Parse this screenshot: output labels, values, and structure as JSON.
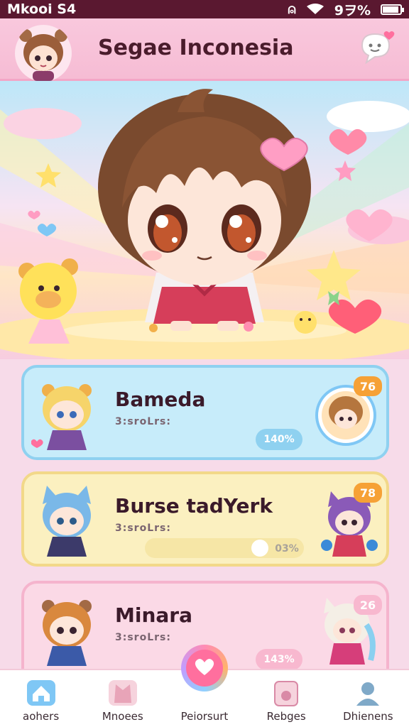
{
  "status": {
    "carrier": "Mkooi S4",
    "battery": "9ヲ%"
  },
  "header": {
    "title": "Segae Inconesia"
  },
  "cards": [
    {
      "name": "Bameda",
      "sub": "3:sroLrs:",
      "badge": "76",
      "pill": "140%"
    },
    {
      "name": "Burse tadYerk",
      "sub": "3:sroLrs:",
      "badge": "78",
      "pill": "03%",
      "progress": 0.03
    },
    {
      "name": "Minara",
      "sub": "3:sroLrs:",
      "badge": "26",
      "pill": "143%"
    }
  ],
  "nav": {
    "items": [
      "aohers",
      "Mnoees",
      "Peiorsurt",
      "Rebges",
      "Dhienens"
    ]
  },
  "colors": {
    "accent": "#ff6f9e",
    "badge": "#f6a136",
    "header": "#f6bcd4"
  }
}
